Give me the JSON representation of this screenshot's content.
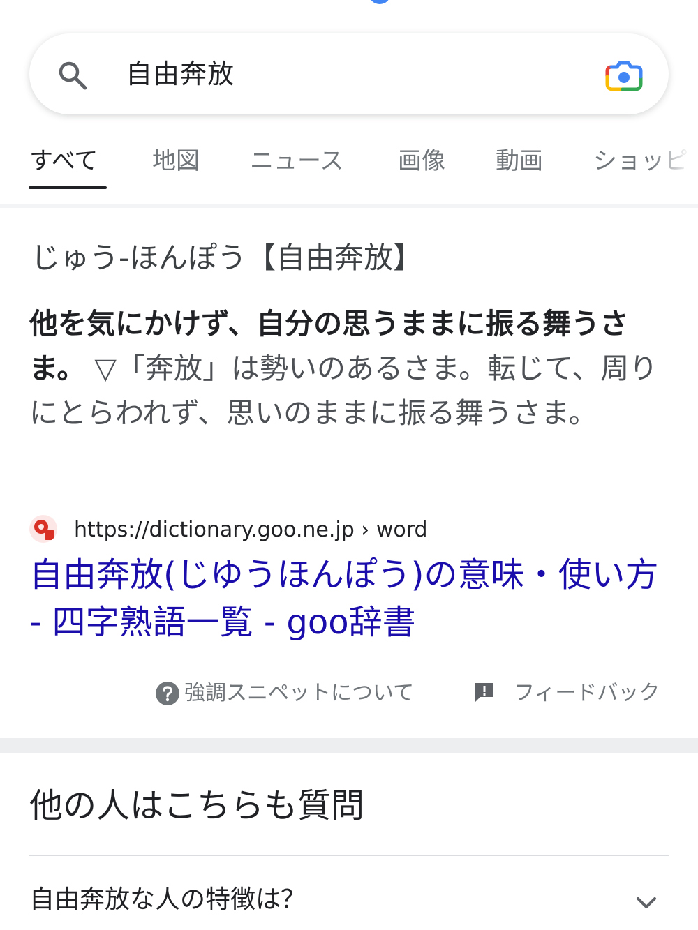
{
  "search": {
    "query": "自由奔放"
  },
  "tabs": [
    {
      "label": "すべて",
      "active": true
    },
    {
      "label": "地図"
    },
    {
      "label": "ニュース"
    },
    {
      "label": "画像"
    },
    {
      "label": "動画"
    },
    {
      "label": "ショッピ"
    }
  ],
  "snippet": {
    "heading": "じゅう-ほんぽう【自由奔放】",
    "bold_text": "他を気にかけず、自分の思うままに振る舞うさま。",
    "plain_text": " ▽「奔放」は勢いのあるさま。転じて、周りにとらわれず、思いのままに振る舞うさま。",
    "source_url": "https://dictionary.goo.ne.jp › word",
    "result_title": "自由奔放(じゆうほんぽう)の意味・使い方 - 四字熟語一覧 - goo辞書",
    "about_label": "強調スニペットについて",
    "feedback_label": "フィードバック"
  },
  "paa": {
    "heading": "他の人はこちらも質問",
    "questions": [
      "自由奔放な人の特徴は？"
    ]
  },
  "icons": {
    "search": "search-icon",
    "lens": "google-lens-icon",
    "help": "help-circle-icon",
    "feedback": "feedback-icon",
    "chevron": "chevron-down-icon"
  },
  "colors": {
    "link": "#1a0dab",
    "google_blue": "#4285f4",
    "google_red": "#ea4335",
    "google_yellow": "#fbbc05",
    "google_green": "#34a853"
  }
}
